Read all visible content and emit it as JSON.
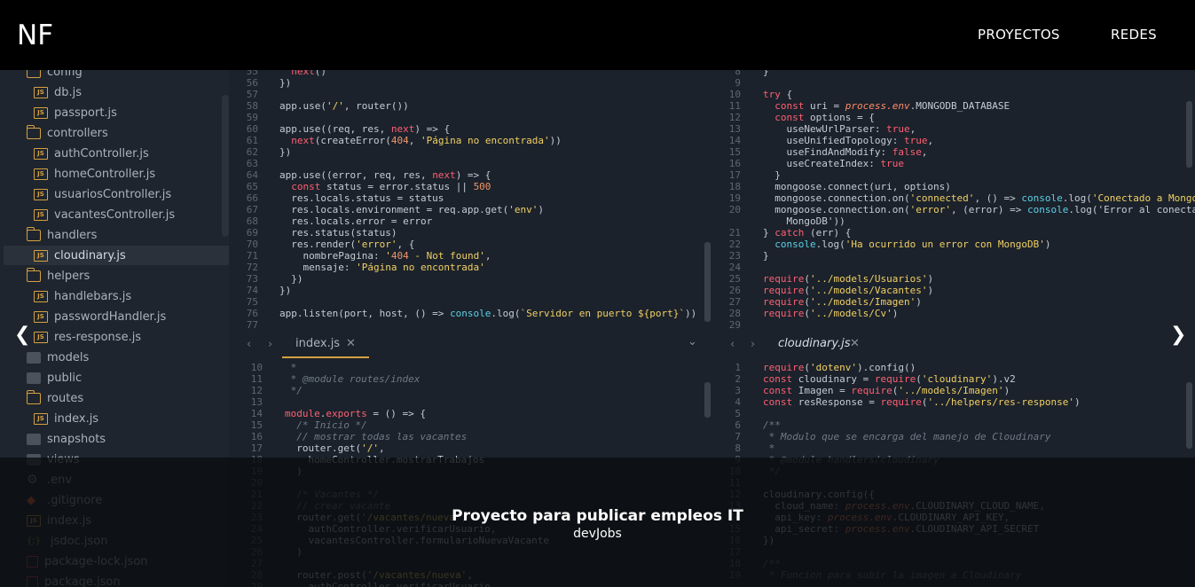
{
  "header": {
    "logo": "NF",
    "nav": [
      "PROYECTOS",
      "REDES"
    ]
  },
  "carousel": {
    "title": "Proyecto para publicar empleos IT",
    "subtitle": "devJobs",
    "prev_icon": "❮",
    "next_icon": "❯"
  },
  "sidebar": {
    "items": [
      {
        "label": "config",
        "type": "folder",
        "indent": 1
      },
      {
        "label": "db.js",
        "type": "js",
        "indent": 2
      },
      {
        "label": "passport.js",
        "type": "js",
        "indent": 2
      },
      {
        "label": "controllers",
        "type": "folder",
        "indent": 1
      },
      {
        "label": "authController.js",
        "type": "js",
        "indent": 2
      },
      {
        "label": "homeController.js",
        "type": "js",
        "indent": 2
      },
      {
        "label": "usuariosController.js",
        "type": "js",
        "indent": 2
      },
      {
        "label": "vacantesController.js",
        "type": "js",
        "indent": 2
      },
      {
        "label": "handlers",
        "type": "folder",
        "indent": 1
      },
      {
        "label": "cloudinary.js",
        "type": "js",
        "indent": 2,
        "selected": true
      },
      {
        "label": "helpers",
        "type": "folder",
        "indent": 1
      },
      {
        "label": "handlebars.js",
        "type": "js",
        "indent": 2
      },
      {
        "label": "passwordHandler.js",
        "type": "js",
        "indent": 2
      },
      {
        "label": "res-response.js",
        "type": "js",
        "indent": 2
      },
      {
        "label": "models",
        "type": "folder-closed",
        "indent": 1
      },
      {
        "label": "public",
        "type": "folder-closed",
        "indent": 1
      },
      {
        "label": "routes",
        "type": "folder",
        "indent": 1
      },
      {
        "label": "index.js",
        "type": "js",
        "indent": 2
      },
      {
        "label": "snapshots",
        "type": "folder-closed",
        "indent": 1
      },
      {
        "label": "views",
        "type": "folder-closed",
        "indent": 1
      },
      {
        "label": ".env",
        "type": "gear",
        "indent": 1
      },
      {
        "label": ".gitignore",
        "type": "git",
        "indent": 1
      },
      {
        "label": "index.js",
        "type": "js",
        "indent": 1
      },
      {
        "label": "jsdoc.json",
        "type": "json",
        "indent": 1
      },
      {
        "label": "package-lock.json",
        "type": "npm",
        "indent": 1
      },
      {
        "label": "package.json",
        "type": "npm",
        "indent": 1
      }
    ]
  },
  "tabs": {
    "left": "index.js",
    "right": "cloudinary.js"
  },
  "code": {
    "top_left_lines": [
      "55",
      "56",
      "57",
      "58",
      "59",
      "60",
      "61",
      "62",
      "63",
      "64",
      "65",
      "66",
      "67",
      "68",
      "69",
      "70",
      "71",
      "72",
      "73",
      "74",
      "75",
      "76",
      "77"
    ],
    "top_left": [
      "  next()",
      "})",
      "",
      "app.use('/', router())",
      "",
      "app.use((req, res, next) => {",
      "  next(createError(404, 'Página no encontrada'))",
      "})",
      "",
      "app.use((error, req, res, next) => {",
      "  const status = error.status || 500",
      "  res.locals.status = status",
      "  res.locals.environment = req.app.get('env')",
      "  res.locals.error = error",
      "  res.status(status)",
      "  res.render('error', {",
      "    nombrePagina: '404 - Not found',",
      "    mensaje: 'Página no encontrada'",
      "  })",
      "})",
      "",
      "app.listen(port, host, () => console.log(`Servidor en puerto ${port}`))",
      ""
    ],
    "top_right_lines": [
      "8",
      "9",
      "10",
      "11",
      "12",
      "13",
      "14",
      "15",
      "16",
      "17",
      "18",
      "19",
      "20",
      "",
      "21",
      "22",
      "23",
      "24",
      "25",
      "26",
      "27",
      "28",
      "29"
    ],
    "top_right": [
      "}",
      "",
      "try {",
      "  const uri = process.env.MONGODB_DATABASE",
      "  const options = {",
      "    useNewUrlParser: true,",
      "    useUnifiedTopology: true,",
      "    useFindAndModify: false,",
      "    useCreateIndex: true",
      "  }",
      "  mongoose.connect(uri, options)",
      "  mongoose.connection.on('connected', () => console.log('Conectado a MongoDB'))",
      "  mongoose.connection.on('error', (error) => console.log('Error al conectar a",
      "    MongoDB'))",
      "} catch (err) {",
      "  console.log('Ha ocurrido un error con MongoDB')",
      "}",
      "",
      "require('../models/Usuarios')",
      "require('../models/Vacantes')",
      "require('../models/Imagen')",
      "require('../models/Cv')",
      ""
    ],
    "bottom_left_lines": [
      "10",
      "11",
      "12",
      "13",
      "14",
      "15",
      "16",
      "17",
      "18",
      "19",
      "20",
      "21",
      "22",
      "23",
      "24",
      "25",
      "26",
      "27",
      "28",
      "29"
    ],
    "bottom_left": [
      " *",
      " * @module routes/index",
      " */",
      "",
      "module.exports = () => {",
      "  /* Inicio */",
      "  // mostrar todas las vacantes",
      "  router.get('/',",
      "    homeController.mostrarTrabajos",
      "  )",
      "",
      "  /* Vacantes */",
      "  // crear vacante",
      "  router.get('/vacantes/nueva',",
      "    authController.verificarUsuario,",
      "    vacantesController.formularioNuevaVacante",
      "  )",
      "",
      "  router.post('/vacantes/nueva',",
      "    authController.verificarUsuario,"
    ],
    "bottom_right_lines": [
      "1",
      "2",
      "3",
      "4",
      "5",
      "6",
      "7",
      "8",
      "9",
      "10",
      "11",
      "12",
      "13",
      "14",
      "15",
      "16",
      "17",
      "18",
      "19"
    ],
    "bottom_right": [
      "require('dotenv').config()",
      "const cloudinary = require('cloudinary').v2",
      "const Imagen = require('../models/Imagen')",
      "const resResponse = require('../helpers/res-response')",
      "",
      "/**",
      " * Modulo que se encarga del manejo de Cloudinary",
      " *",
      " * @module handlers/cloudinary",
      " */",
      "",
      "cloudinary.config({",
      "  cloud_name: process.env.CLOUDINARY_CLOUD_NAME,",
      "  api_key: process.env.CLOUDINARY_API_KEY,",
      "  api_secret: process.env.CLOUDINARY_API_SECRET",
      "})",
      "",
      "/**",
      " * Funcion para subir la imagen a Cloudinary"
    ]
  }
}
